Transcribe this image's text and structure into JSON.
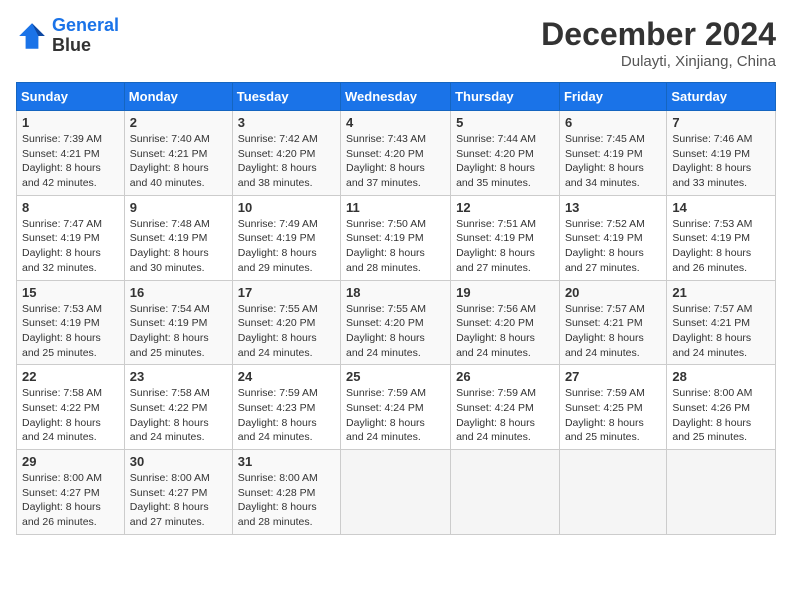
{
  "header": {
    "logo_line1": "General",
    "logo_line2": "Blue",
    "month": "December 2024",
    "location": "Dulayti, Xinjiang, China"
  },
  "weekdays": [
    "Sunday",
    "Monday",
    "Tuesday",
    "Wednesday",
    "Thursday",
    "Friday",
    "Saturday"
  ],
  "weeks": [
    [
      {
        "day": "1",
        "sunrise": "7:39 AM",
        "sunset": "4:21 PM",
        "daylight": "8 hours and 42 minutes."
      },
      {
        "day": "2",
        "sunrise": "7:40 AM",
        "sunset": "4:21 PM",
        "daylight": "8 hours and 40 minutes."
      },
      {
        "day": "3",
        "sunrise": "7:42 AM",
        "sunset": "4:20 PM",
        "daylight": "8 hours and 38 minutes."
      },
      {
        "day": "4",
        "sunrise": "7:43 AM",
        "sunset": "4:20 PM",
        "daylight": "8 hours and 37 minutes."
      },
      {
        "day": "5",
        "sunrise": "7:44 AM",
        "sunset": "4:20 PM",
        "daylight": "8 hours and 35 minutes."
      },
      {
        "day": "6",
        "sunrise": "7:45 AM",
        "sunset": "4:19 PM",
        "daylight": "8 hours and 34 minutes."
      },
      {
        "day": "7",
        "sunrise": "7:46 AM",
        "sunset": "4:19 PM",
        "daylight": "8 hours and 33 minutes."
      }
    ],
    [
      {
        "day": "8",
        "sunrise": "7:47 AM",
        "sunset": "4:19 PM",
        "daylight": "8 hours and 32 minutes."
      },
      {
        "day": "9",
        "sunrise": "7:48 AM",
        "sunset": "4:19 PM",
        "daylight": "8 hours and 30 minutes."
      },
      {
        "day": "10",
        "sunrise": "7:49 AM",
        "sunset": "4:19 PM",
        "daylight": "8 hours and 29 minutes."
      },
      {
        "day": "11",
        "sunrise": "7:50 AM",
        "sunset": "4:19 PM",
        "daylight": "8 hours and 28 minutes."
      },
      {
        "day": "12",
        "sunrise": "7:51 AM",
        "sunset": "4:19 PM",
        "daylight": "8 hours and 27 minutes."
      },
      {
        "day": "13",
        "sunrise": "7:52 AM",
        "sunset": "4:19 PM",
        "daylight": "8 hours and 27 minutes."
      },
      {
        "day": "14",
        "sunrise": "7:53 AM",
        "sunset": "4:19 PM",
        "daylight": "8 hours and 26 minutes."
      }
    ],
    [
      {
        "day": "15",
        "sunrise": "7:53 AM",
        "sunset": "4:19 PM",
        "daylight": "8 hours and 25 minutes."
      },
      {
        "day": "16",
        "sunrise": "7:54 AM",
        "sunset": "4:19 PM",
        "daylight": "8 hours and 25 minutes."
      },
      {
        "day": "17",
        "sunrise": "7:55 AM",
        "sunset": "4:20 PM",
        "daylight": "8 hours and 24 minutes."
      },
      {
        "day": "18",
        "sunrise": "7:55 AM",
        "sunset": "4:20 PM",
        "daylight": "8 hours and 24 minutes."
      },
      {
        "day": "19",
        "sunrise": "7:56 AM",
        "sunset": "4:20 PM",
        "daylight": "8 hours and 24 minutes."
      },
      {
        "day": "20",
        "sunrise": "7:57 AM",
        "sunset": "4:21 PM",
        "daylight": "8 hours and 24 minutes."
      },
      {
        "day": "21",
        "sunrise": "7:57 AM",
        "sunset": "4:21 PM",
        "daylight": "8 hours and 24 minutes."
      }
    ],
    [
      {
        "day": "22",
        "sunrise": "7:58 AM",
        "sunset": "4:22 PM",
        "daylight": "8 hours and 24 minutes."
      },
      {
        "day": "23",
        "sunrise": "7:58 AM",
        "sunset": "4:22 PM",
        "daylight": "8 hours and 24 minutes."
      },
      {
        "day": "24",
        "sunrise": "7:59 AM",
        "sunset": "4:23 PM",
        "daylight": "8 hours and 24 minutes."
      },
      {
        "day": "25",
        "sunrise": "7:59 AM",
        "sunset": "4:24 PM",
        "daylight": "8 hours and 24 minutes."
      },
      {
        "day": "26",
        "sunrise": "7:59 AM",
        "sunset": "4:24 PM",
        "daylight": "8 hours and 24 minutes."
      },
      {
        "day": "27",
        "sunrise": "7:59 AM",
        "sunset": "4:25 PM",
        "daylight": "8 hours and 25 minutes."
      },
      {
        "day": "28",
        "sunrise": "8:00 AM",
        "sunset": "4:26 PM",
        "daylight": "8 hours and 25 minutes."
      }
    ],
    [
      {
        "day": "29",
        "sunrise": "8:00 AM",
        "sunset": "4:27 PM",
        "daylight": "8 hours and 26 minutes."
      },
      {
        "day": "30",
        "sunrise": "8:00 AM",
        "sunset": "4:27 PM",
        "daylight": "8 hours and 27 minutes."
      },
      {
        "day": "31",
        "sunrise": "8:00 AM",
        "sunset": "4:28 PM",
        "daylight": "8 hours and 28 minutes."
      },
      null,
      null,
      null,
      null
    ]
  ]
}
